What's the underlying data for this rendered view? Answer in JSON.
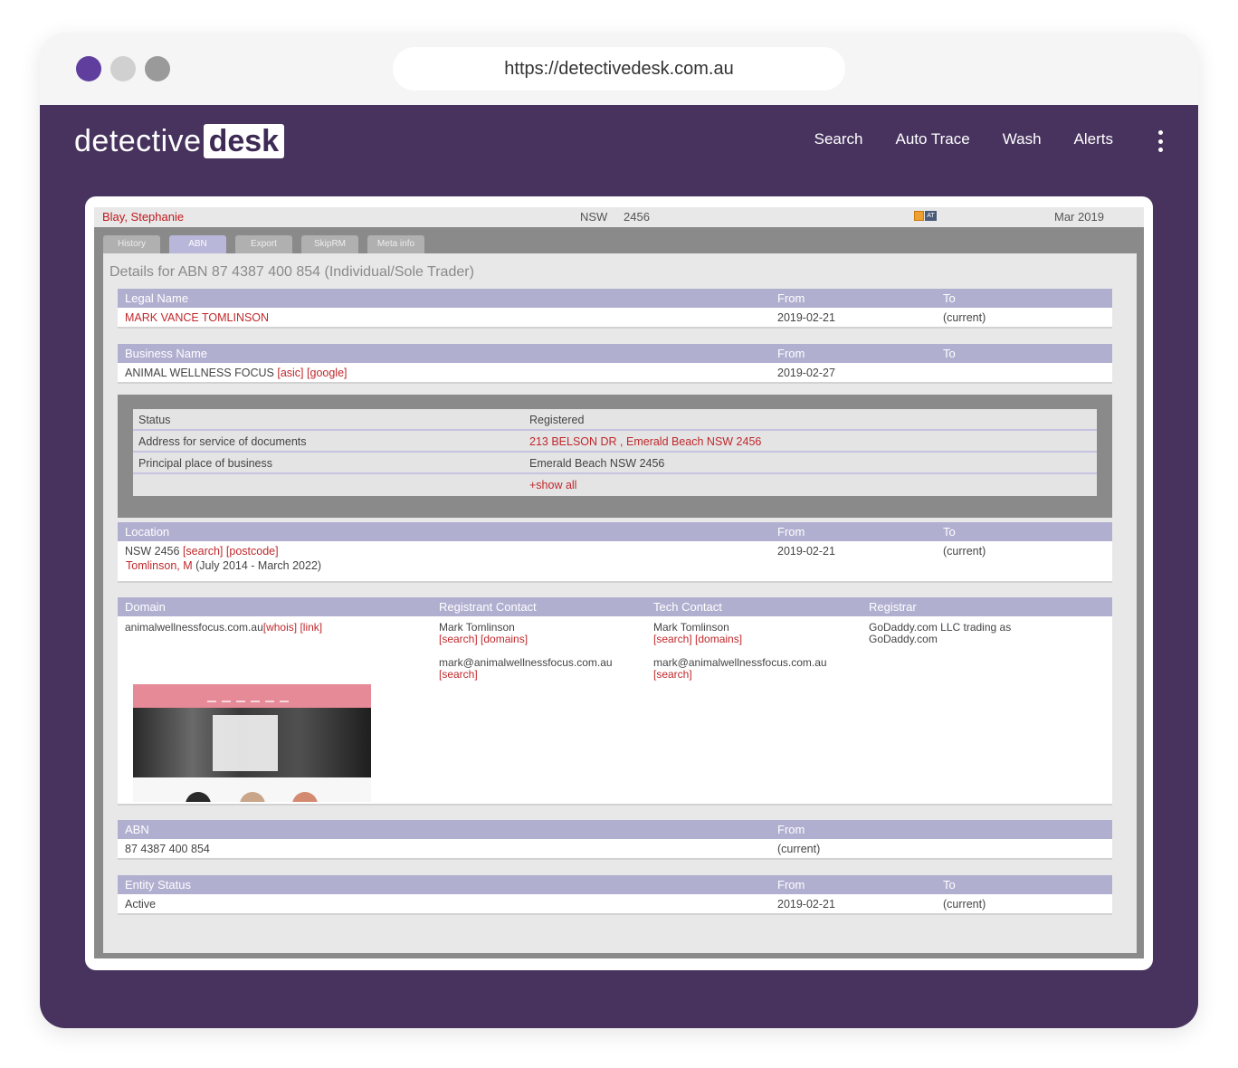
{
  "browser": {
    "url": "https://detectivedesk.com.au"
  },
  "app": {
    "logo": {
      "part1": "detective",
      "part2": "desk"
    },
    "nav": [
      "Search",
      "Auto Trace",
      "Wash",
      "Alerts"
    ]
  },
  "record": {
    "name": "Blay, Stephanie",
    "state": "NSW",
    "postcode": "2456",
    "date": "Mar 2019",
    "icons": {
      "calendar": "calendar-icon",
      "at": "AT"
    }
  },
  "tabs": [
    "History",
    "ABN",
    "Export",
    "SkipRM",
    "Meta info"
  ],
  "details_title": "Details for ABN 87 4387 400 854 (Individual/Sole Trader)",
  "legal_name": {
    "headers": [
      "Legal Name",
      "From",
      "To"
    ],
    "value": "MARK VANCE TOMLINSON",
    "from": "2019-02-21",
    "to": "(current)"
  },
  "business_name": {
    "headers": [
      "Business Name",
      "From",
      "To"
    ],
    "value": "ANIMAL WELLNESS FOCUS",
    "links": [
      "[asic]",
      "[google]"
    ],
    "from": "2019-02-27",
    "details": [
      {
        "key": "Status",
        "value": "Registered"
      },
      {
        "key": "Address for service of documents",
        "value": "213 BELSON DR , Emerald Beach NSW 2456"
      },
      {
        "key": "Principal place of business",
        "value": "Emerald Beach NSW 2456"
      }
    ],
    "show_all": "+show all"
  },
  "location": {
    "headers": [
      "Location",
      "From",
      "To"
    ],
    "value": "NSW 2456",
    "links": [
      "[search]",
      "[postcode]"
    ],
    "person": "Tomlinson, M",
    "person_range": "(July 2014 - March 2022)",
    "from": "2019-02-21",
    "to": "(current)"
  },
  "domain": {
    "headers": [
      "Domain",
      "Registrant Contact",
      "Tech Contact",
      "Registrar"
    ],
    "value": "animalwellnessfocus.com.au",
    "links": [
      "[whois]",
      "[link]"
    ],
    "registrant": {
      "name": "Mark Tomlinson",
      "links": "[search] [domains]",
      "email": "mark@animalwellnessfocus.com.au",
      "email_link": "[search]"
    },
    "tech": {
      "name": "Mark Tomlinson",
      "links": "[search] [domains]",
      "email": "mark@animalwellnessfocus.com.au",
      "email_link": "[search]"
    },
    "registrar": {
      "line1": "GoDaddy.com LLC trading as",
      "line2": "GoDaddy.com"
    }
  },
  "abn": {
    "headers": [
      "ABN",
      "From"
    ],
    "value": "87 4387 400 854",
    "from": "(current)"
  },
  "entity_status": {
    "headers": [
      "Entity Status",
      "From",
      "To"
    ],
    "value": "Active",
    "from": "2019-02-21",
    "to": "(current)"
  },
  "colors": {
    "brand": "#47335e",
    "accent_red": "#c0282c",
    "header_lavender": "#b1afd0"
  }
}
